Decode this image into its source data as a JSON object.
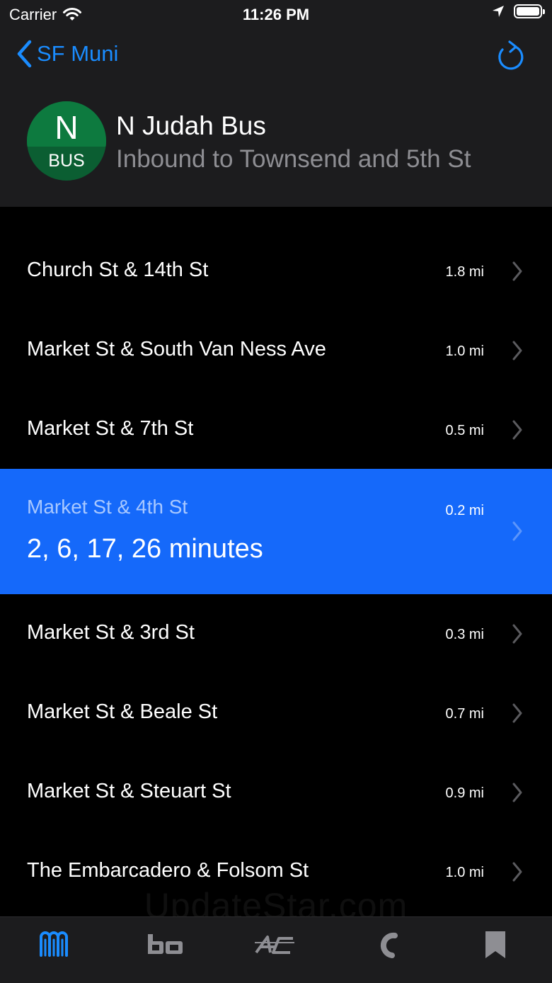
{
  "status_bar": {
    "carrier": "Carrier",
    "time": "11:26 PM",
    "wifi_icon": "wifi-icon",
    "location_icon": "location-arrow-icon",
    "battery_icon": "battery-full-icon"
  },
  "nav": {
    "back_label": "SF Muni",
    "back_icon": "chevron-left-icon",
    "refresh_icon": "refresh-icon",
    "accent_color": "#1a8cff"
  },
  "route": {
    "badge_letter": "N",
    "badge_type": "BUS",
    "badge_color": "#0d7a3f",
    "title": "N Judah Bus",
    "subtitle": "Inbound to Townsend and 5th St"
  },
  "stops": [
    {
      "name": "Church St & 14th St",
      "distance": "1.8 mi"
    },
    {
      "name": "Market St & South Van Ness Ave",
      "distance": "1.0 mi"
    },
    {
      "name": "Market St & 7th St",
      "distance": "0.5 mi"
    },
    {
      "name": "Market St & 4th St",
      "distance": "0.2 mi",
      "arrivals": "2, 6, 17, 26 minutes",
      "selected": true
    },
    {
      "name": "Market St & 3rd St",
      "distance": "0.3 mi"
    },
    {
      "name": "Market St & Beale St",
      "distance": "0.7 mi"
    },
    {
      "name": "Market St & Steuart St",
      "distance": "0.9 mi"
    },
    {
      "name": "The Embarcadero & Folsom St",
      "distance": "1.0 mi"
    }
  ],
  "selected_color": "#1569fa",
  "watermark": "UpdateStar.com",
  "tabs": [
    {
      "icon": "muni-logo-icon",
      "active": true
    },
    {
      "icon": "bart-logo-icon",
      "active": false
    },
    {
      "icon": "ac-transit-logo-icon",
      "active": false
    },
    {
      "icon": "caltrain-logo-icon",
      "active": false
    },
    {
      "icon": "bookmark-icon",
      "active": false
    }
  ]
}
